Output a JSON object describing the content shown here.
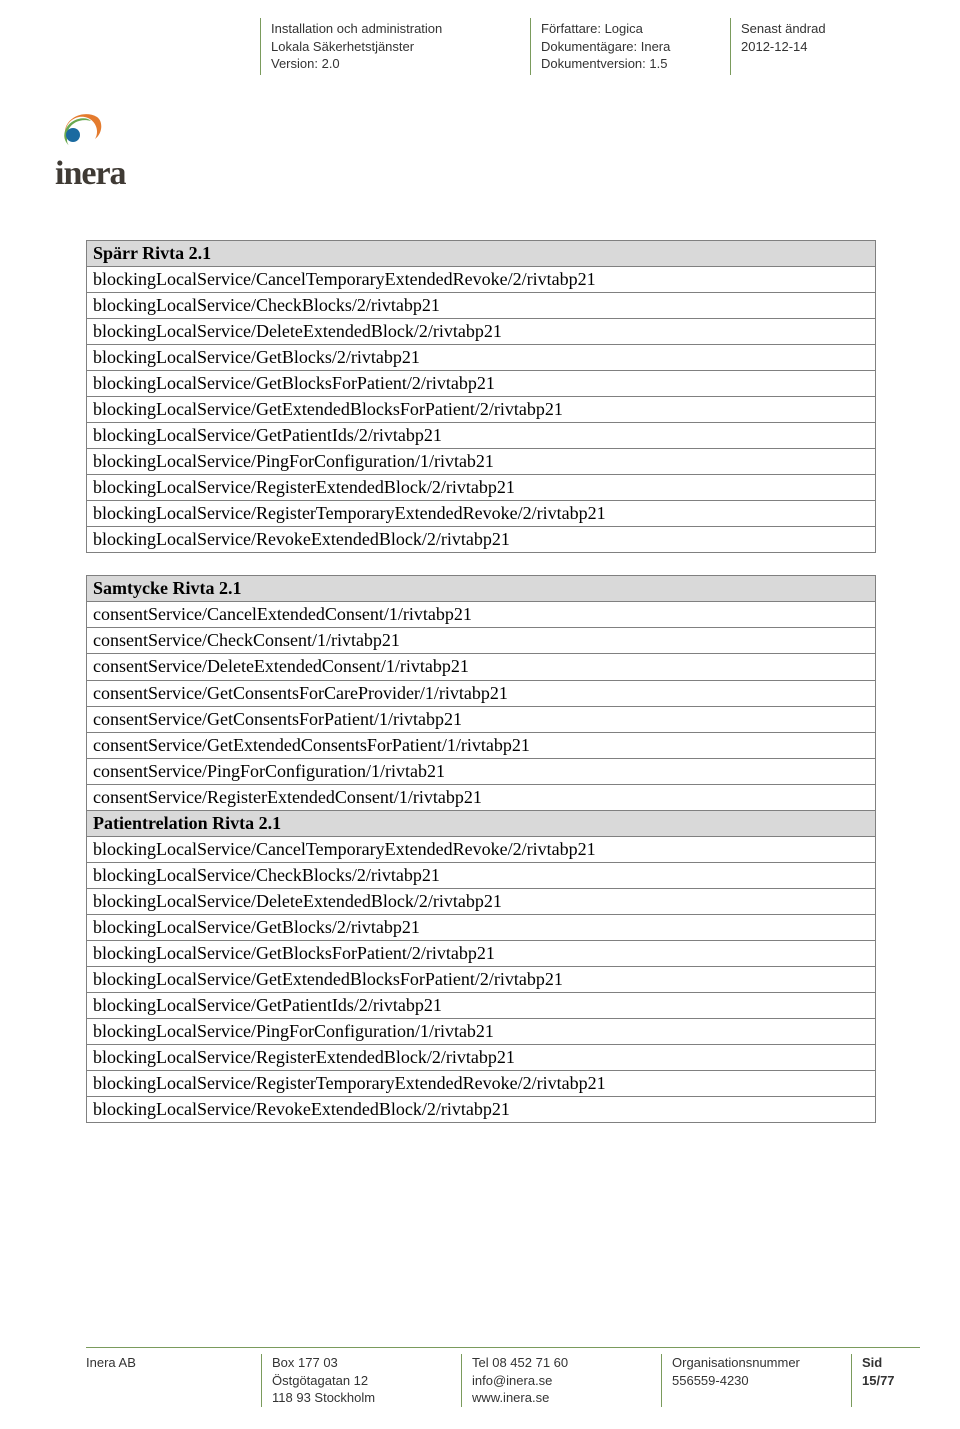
{
  "header": {
    "col1": {
      "l1": "Installation och administration",
      "l2": "Lokala Säkerhetstjänster",
      "l3": "Version: 2.0"
    },
    "col2": {
      "l1": "Författare: Logica",
      "l2": "Dokumentägare: Inera",
      "l3": "Dokumentversion: 1.5"
    },
    "col3": {
      "l1": "Senast ändrad",
      "l2": "2012-12-14"
    }
  },
  "logo_text": "inera",
  "tables": [
    {
      "header": "Spärr Rivta 2.1",
      "rows": [
        "blockingLocalService/CancelTemporaryExtendedRevoke/2/rivtabp21",
        "blockingLocalService/CheckBlocks/2/rivtabp21",
        "blockingLocalService/DeleteExtendedBlock/2/rivtabp21",
        "blockingLocalService/GetBlocks/2/rivtabp21",
        "blockingLocalService/GetBlocksForPatient/2/rivtabp21",
        "blockingLocalService/GetExtendedBlocksForPatient/2/rivtabp21",
        "blockingLocalService/GetPatientIds/2/rivtabp21",
        "blockingLocalService/PingForConfiguration/1/rivtab21",
        "blockingLocalService/RegisterExtendedBlock/2/rivtabp21",
        "blockingLocalService/RegisterTemporaryExtendedRevoke/2/rivtabp21",
        "blockingLocalService/RevokeExtendedBlock/2/rivtabp21"
      ]
    },
    {
      "sections": [
        {
          "header": "Samtycke Rivta 2.1",
          "rows": [
            "consentService/CancelExtendedConsent/1/rivtabp21",
            "consentService/CheckConsent/1/rivtabp21",
            "consentService/DeleteExtendedConsent/1/rivtabp21",
            "consentService/GetConsentsForCareProvider/1/rivtabp21",
            "consentService/GetConsentsForPatient/1/rivtabp21",
            "consentService/GetExtendedConsentsForPatient/1/rivtabp21",
            "consentService/PingForConfiguration/1/rivtab21",
            "consentService/RegisterExtendedConsent/1/rivtabp21"
          ]
        },
        {
          "header": "Patientrelation Rivta 2.1",
          "rows": [
            "blockingLocalService/CancelTemporaryExtendedRevoke/2/rivtabp21",
            "blockingLocalService/CheckBlocks/2/rivtabp21",
            "blockingLocalService/DeleteExtendedBlock/2/rivtabp21",
            "blockingLocalService/GetBlocks/2/rivtabp21",
            "blockingLocalService/GetBlocksForPatient/2/rivtabp21",
            "blockingLocalService/GetExtendedBlocksForPatient/2/rivtabp21",
            "blockingLocalService/GetPatientIds/2/rivtabp21",
            "blockingLocalService/PingForConfiguration/1/rivtab21",
            "blockingLocalService/RegisterExtendedBlock/2/rivtabp21",
            "blockingLocalService/RegisterTemporaryExtendedRevoke/2/rivtabp21",
            "blockingLocalService/RevokeExtendedBlock/2/rivtabp21"
          ]
        }
      ]
    }
  ],
  "footer": {
    "company": "Inera AB",
    "address": {
      "l1": "Box 177 03",
      "l2": "Östgötagatan 12",
      "l3": "118 93 Stockholm"
    },
    "contact": {
      "l1": "Tel 08 452 71 60",
      "l2": "info@inera.se",
      "l3": "www.inera.se"
    },
    "org": {
      "l1": "Organisationsnummer",
      "l2": "556559-4230"
    },
    "page": "Sid 15/77"
  }
}
